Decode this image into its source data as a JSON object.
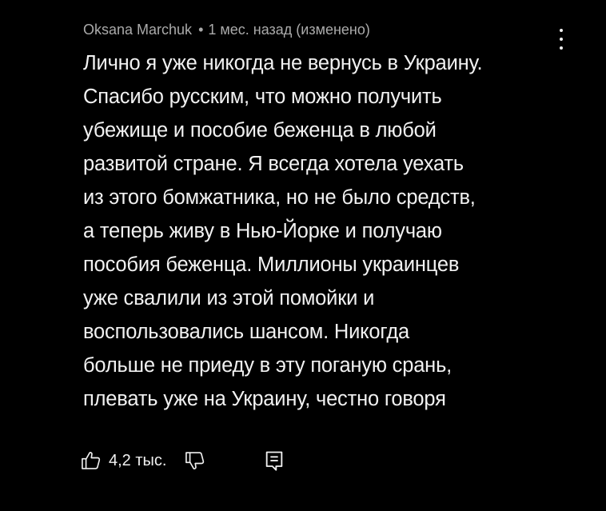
{
  "comment": {
    "author": "Oksana Marchuk",
    "separator": "•",
    "time": "1 мес. назад",
    "edited": "(изменено)",
    "lines": [
      "Лично я уже никогда не вернусь в Украину.",
      "Спасибо русским, что можно получить",
      "убежище и пособие беженца в любой",
      "развитой стране. Я всегда хотела уехать",
      "из этого бомжатника, но не было средств,",
      "а теперь живу в Нью-Йорке и получаю",
      "пособия беженца. Миллионы украинцев",
      "уже свалили из этой помойки и",
      "воспользовались шансом. Никогда",
      "больше не приеду в эту поганую срань,",
      "плевать уже на Украину, честно говоря"
    ],
    "like_count": "4,2 тыс.",
    "icons": {
      "like": "thumbs-up-icon",
      "dislike": "thumbs-down-icon",
      "reply": "reply-icon",
      "menu": "more-vert-icon"
    }
  },
  "colors": {
    "background": "#000000",
    "text": "#f1f1f1",
    "meta": "#aaaaaa"
  }
}
